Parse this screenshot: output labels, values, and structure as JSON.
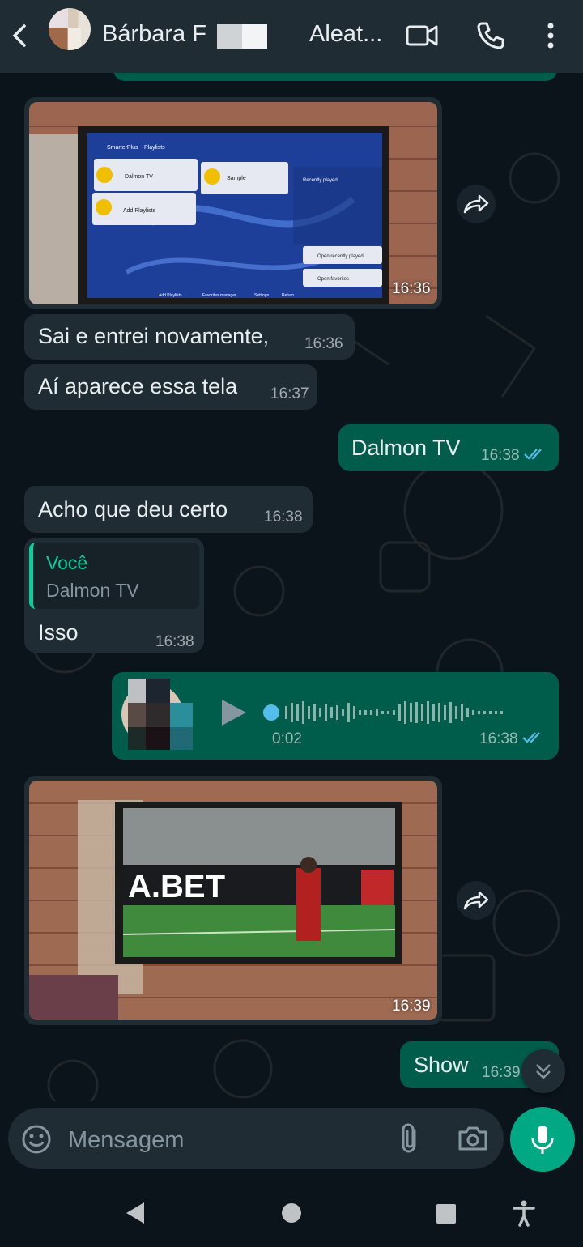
{
  "header": {
    "contact_name": "Bárbara F",
    "status": "Aleat..."
  },
  "messages": {
    "img1": {
      "time": "16:36"
    },
    "m1": {
      "text": "Sai e entrei novamente,",
      "time": "16:36"
    },
    "m2": {
      "text": "Aí aparece essa tela",
      "time": "16:37"
    },
    "m3": {
      "text": "Dalmon TV",
      "time": "16:38"
    },
    "m4": {
      "text": "Acho que deu certo",
      "time": "16:38"
    },
    "m5": {
      "quote_author": "Você",
      "quote_text": "Dalmon TV",
      "text": "Isso",
      "time": "16:38"
    },
    "voice": {
      "duration": "0:02",
      "time": "16:38"
    },
    "img2": {
      "time": "16:39"
    },
    "m6": {
      "text": "Show",
      "time": "16:39"
    }
  },
  "tv_screen1": {
    "app_name": "SmarterPlus",
    "section": "Playlists",
    "tile1": "Dalmon TV",
    "tile2": "Sample",
    "tile3": "Add Playlists",
    "recent": "Recently played",
    "open_recent": "Open recently played",
    "open_fav": "Open favorites",
    "footer1": "Add Playlists",
    "footer2": "Favorites manager",
    "footer3": "Settings",
    "footer4": "Return"
  },
  "tv_screen2": {
    "banner": "A.BET"
  },
  "composer": {
    "placeholder": "Mensagem"
  },
  "colors": {
    "background": "#0b141a",
    "incoming": "#1f2c34",
    "outgoing": "#005c4b",
    "accent": "#00a884",
    "read_check": "#53bdeb"
  }
}
